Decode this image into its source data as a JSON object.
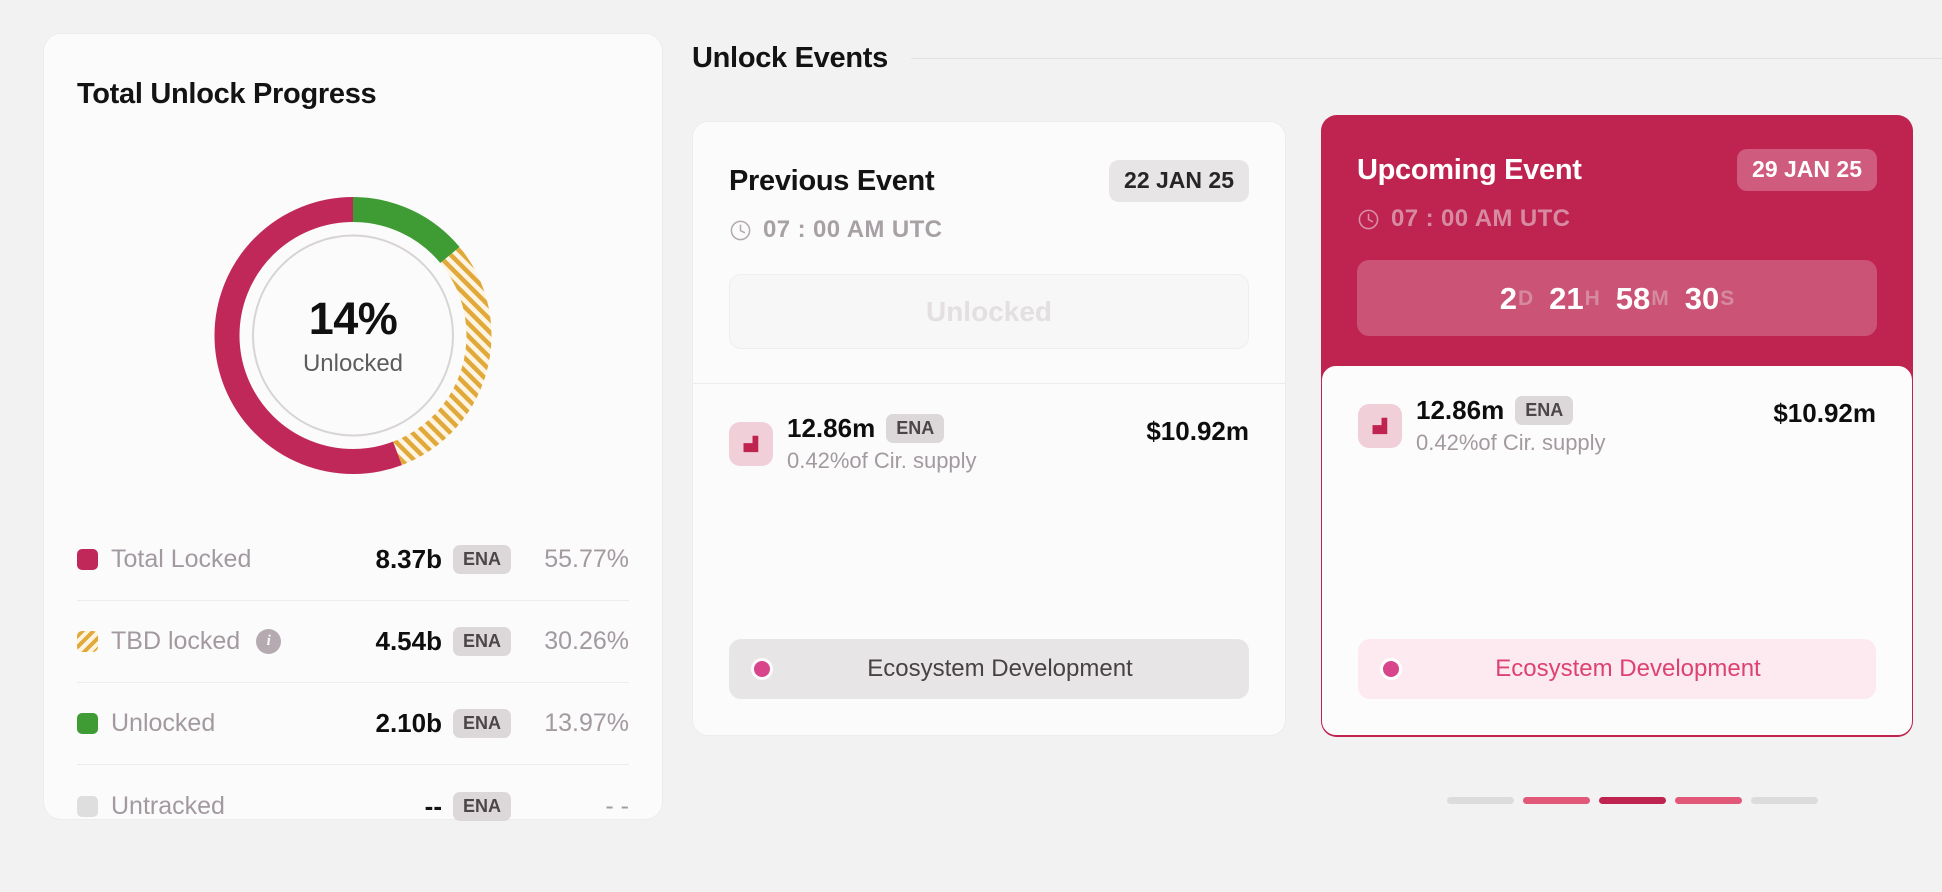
{
  "progress": {
    "title": "Total Unlock Progress",
    "donut": {
      "percent_label": "14%",
      "sub_label": "Unlocked"
    },
    "legend": [
      {
        "label": "Total Locked",
        "value": "8.37b",
        "unit": "ENA",
        "percent": "55.77%",
        "swatch": "crimson-swatch",
        "info": false
      },
      {
        "label": "TBD locked",
        "value": "4.54b",
        "unit": "ENA",
        "percent": "30.26%",
        "swatch": "striped-gold-swatch",
        "info": true,
        "info_icon": "info-icon"
      },
      {
        "label": "Unlocked",
        "value": "2.10b",
        "unit": "ENA",
        "percent": "13.97%",
        "swatch": "green-swatch",
        "info": false
      },
      {
        "label": "Untracked",
        "value": "--",
        "unit": "ENA",
        "percent": "- -",
        "swatch": "grey-swatch",
        "info": false
      }
    ]
  },
  "events": {
    "section_title": "Unlock Events",
    "previous": {
      "title": "Previous Event",
      "date": "22 JAN 25",
      "clock_icon": "clock-icon",
      "time": "07 : 00 AM UTC",
      "status": "Unlocked",
      "token": {
        "logo_icon": "ena-token-icon",
        "amount": "12.86m",
        "unit": "ENA",
        "supply_note": "0.42%of Cir. supply",
        "usd": "$10.92m"
      },
      "category": "Ecosystem Development"
    },
    "upcoming": {
      "title": "Upcoming Event",
      "date": "29 JAN 25",
      "clock_icon": "clock-icon",
      "time": "07 : 00 AM UTC",
      "countdown": {
        "days": "2",
        "days_unit": "D",
        "hours": "21",
        "hours_unit": "H",
        "minutes": "58",
        "minutes_unit": "M",
        "seconds": "30",
        "seconds_unit": "S"
      },
      "token": {
        "logo_icon": "ena-token-icon",
        "amount": "12.86m",
        "unit": "ENA",
        "supply_note": "0.42%of Cir. supply",
        "usd": "$10.92m"
      },
      "category": "Ecosystem Development"
    },
    "pagination": [
      {
        "state": "inactive",
        "color": "#dcdcdc"
      },
      {
        "state": "near",
        "color": "#e25878"
      },
      {
        "state": "active",
        "color": "#bf2450"
      },
      {
        "state": "near",
        "color": "#e25878"
      },
      {
        "state": "inactive",
        "color": "#dcdcdc"
      }
    ]
  },
  "colors": {
    "crimson": "#bf2450",
    "locked": "#c1285a",
    "green": "#3f9c35",
    "gold": "#e0a93a",
    "grey": "#dedede",
    "pink_dot": "#d9458a"
  }
}
